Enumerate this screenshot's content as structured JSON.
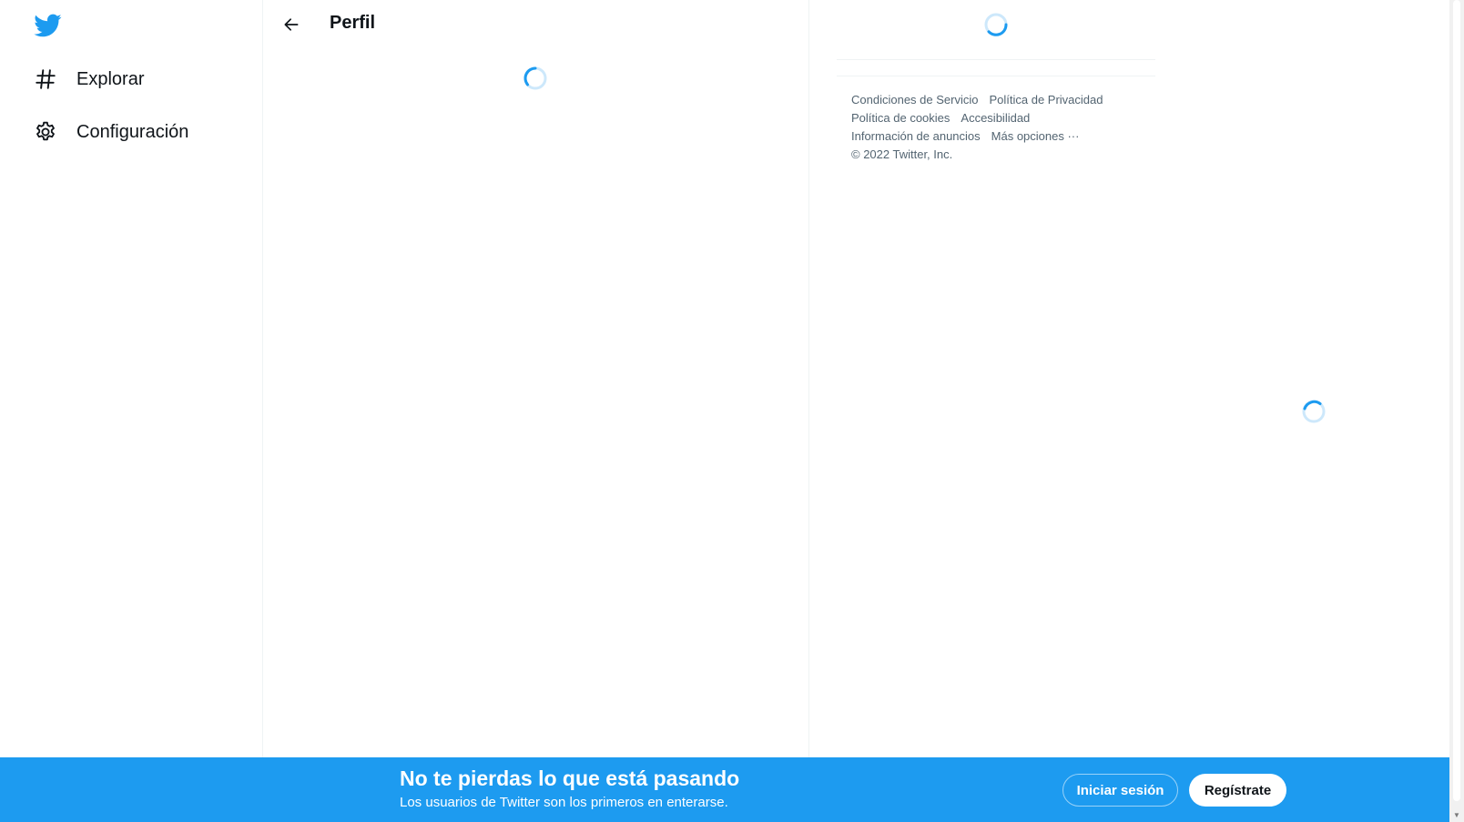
{
  "nav": {
    "logo_icon": "twitter-bird-icon",
    "items": [
      {
        "label": "Explorar",
        "icon": "hashtag-icon"
      },
      {
        "label": "Configuración",
        "icon": "gear-icon"
      }
    ]
  },
  "main": {
    "title": "Perfil",
    "back_icon": "arrow-left-icon"
  },
  "right": {
    "footer": {
      "links": [
        "Condiciones de Servicio",
        "Política de Privacidad",
        "Política de cookies",
        "Accesibilidad",
        "Información de anuncios",
        "Más opciones ···"
      ],
      "copyright": "© 2022 Twitter, Inc."
    }
  },
  "bottom_bar": {
    "title": "No te pierdas lo que está pasando",
    "subtitle": "Los usuarios de Twitter son los primeros en enterarse.",
    "login_label": "Iniciar sesión",
    "signup_label": "Regístrate"
  },
  "colors": {
    "brand": "#1d9bf0",
    "text": "#0f1419",
    "muted": "#536471",
    "border": "#eff3f4"
  }
}
